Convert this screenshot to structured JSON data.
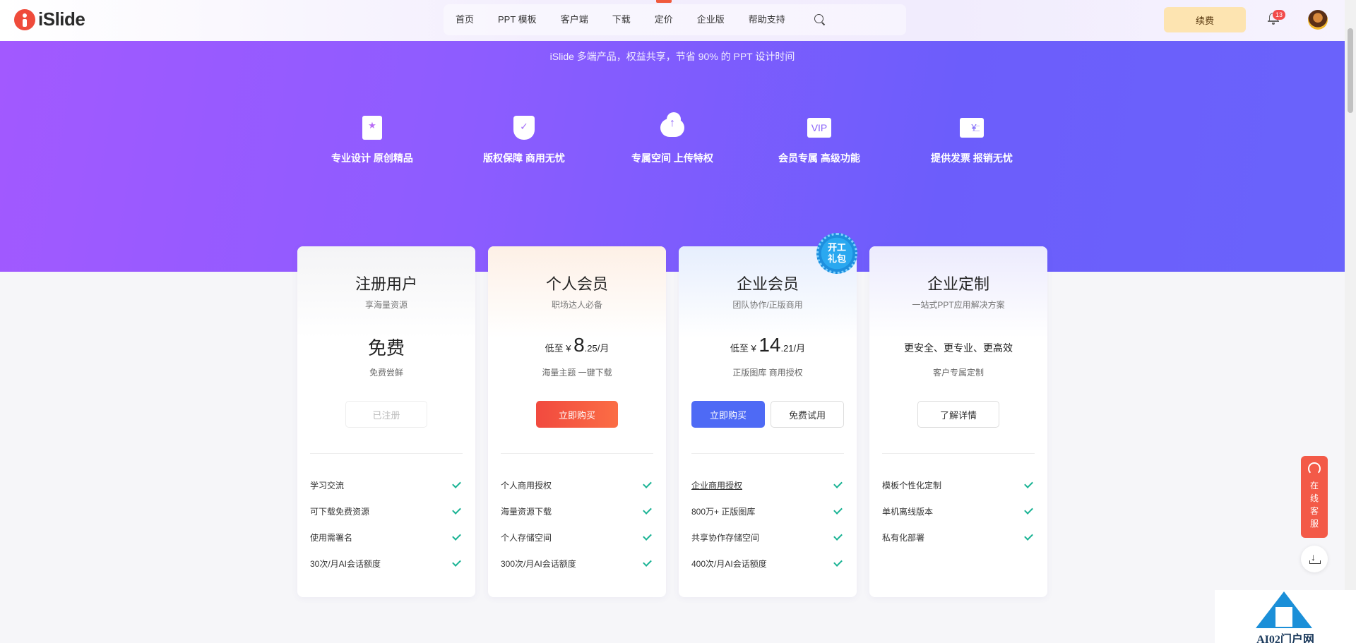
{
  "header": {
    "logo_text": "iSlide",
    "nav": [
      "首页",
      "PPT 模板",
      "客户端",
      "下载",
      "定价",
      "企业版",
      "帮助支持"
    ],
    "active_nav": "定价",
    "renew_label": "续费",
    "notification_count": "13"
  },
  "hero": {
    "subtitle": "iSlide 多端产品，权益共享，节省 90% 的 PPT 设计时间",
    "benefits": [
      {
        "label": "专业设计 原创精品",
        "icon": "design-doc-icon"
      },
      {
        "label": "版权保障 商用无忧",
        "icon": "shield-icon"
      },
      {
        "label": "专属空间 上传特权",
        "icon": "cloud-upload-icon"
      },
      {
        "label": "会员专属 高级功能",
        "icon": "vip-icon",
        "icon_text": "VIP"
      },
      {
        "label": "提供发票 报销无忧",
        "icon": "invoice-icon",
        "icon_text": "¥"
      }
    ]
  },
  "plans": [
    {
      "title": "注册用户",
      "subtitle": "享海量资源",
      "price": "免费",
      "desc": "免费尝鲜",
      "button": "已注册",
      "features": [
        "学习交流",
        "可下载免费资源",
        "使用需署名",
        "30次/月AI会话额度"
      ]
    },
    {
      "title": "个人会员",
      "subtitle": "职场达人必备",
      "price_prefix": "低至 ¥ ",
      "price_int": "8",
      "price_suffix": ".25/月",
      "desc": "海量主题 一键下载",
      "button": "立即购买",
      "features": [
        "个人商用授权",
        "海量资源下载",
        "个人存储空间",
        "300次/月AI会话额度"
      ]
    },
    {
      "title": "企业会员",
      "subtitle": "团队协作/正版商用",
      "price_prefix": "低至 ¥ ",
      "price_int": "14",
      "price_suffix": ".21/月",
      "desc": "正版图库 商用授权",
      "button": "立即购买",
      "button2": "免费试用",
      "badge_line1": "开工",
      "badge_line2": "礼包",
      "features": [
        "企业商用授权",
        "800万+ 正版图库",
        "共享协作存储空间",
        "400次/月AI会话额度"
      ]
    },
    {
      "title": "企业定制",
      "subtitle": "一站式PPT应用解决方案",
      "price": "更安全、更专业、更高效",
      "desc": "客户专属定制",
      "button": "了解详情",
      "features": [
        "模板个性化定制",
        "单机离线版本",
        "私有化部署"
      ]
    }
  ],
  "float": {
    "support_chars": [
      "在",
      "线",
      "客",
      "服"
    ]
  },
  "watermark": {
    "text": "AI02门户网"
  },
  "colors": {
    "hero_start": "#a259ff",
    "hero_end": "#6a63fb",
    "buy_orange": "#f14a3f",
    "buy_blue": "#4e6af5",
    "check_green": "#1ab394",
    "support_red": "#f35a48"
  }
}
